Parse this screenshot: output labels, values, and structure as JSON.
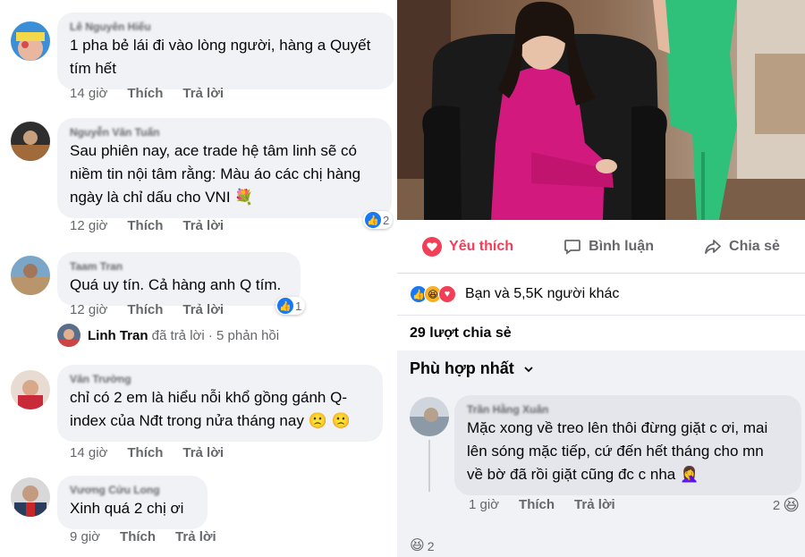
{
  "left": {
    "comments": [
      {
        "name": "Lê Nguyên Hiếu",
        "lines": [
          "1 pha bẻ lái đi vào lòng người, hàng a Quyết",
          "tím hết"
        ],
        "time": "14 giờ",
        "like": "Thích",
        "reply": "Trả lời"
      },
      {
        "name": "Nguyễn Văn Tuấn",
        "lines": [
          "Sau phiên nay, ace trade hệ tâm linh sẽ có",
          "niềm tin nội tâm rằng: Màu áo các chị hàng",
          "ngày là chỉ dấu cho VNI 💐"
        ],
        "time": "12 giờ",
        "like": "Thích",
        "reply": "Trả lời",
        "reaction_count": "2"
      },
      {
        "name": "Taam Tran",
        "lines": [
          "Quá uy tín. Cả hàng anh Q tím."
        ],
        "time": "12 giờ",
        "like": "Thích",
        "reply": "Trả lời",
        "reaction_count": "1"
      },
      {
        "name": "Văn Trường",
        "lines": [
          "chỉ có 2 em là hiểu nỗi khổ gồng gánh Q-",
          "index của Nđt trong nửa tháng nay 🙁 🙁"
        ],
        "time": "14 giờ",
        "like": "Thích",
        "reply": "Trả lời"
      },
      {
        "name": "Vương Cửu Long",
        "lines": [
          "Xinh quá 2 chị ơi"
        ],
        "time": "9 giờ",
        "like": "Thích",
        "reply": "Trả lời"
      }
    ],
    "reply_summary": {
      "name": "Linh Tran",
      "text": "đã trả lời · 5 phản hồi"
    }
  },
  "right": {
    "actions": {
      "like": "Yêu thích",
      "comment": "Bình luận",
      "share": "Chia sẻ"
    },
    "reactions_summary": "Bạn và 5,5K người khác",
    "shares": "29 lượt chia sẻ",
    "sort": "Phù hợp nhất",
    "comment": {
      "name": "Trần Hằng Xuân",
      "lines": [
        "Mặc xong về treo lên thôi đừng giặt c ơi, mai",
        "lên sóng mặc tiếp, cứ đến hết tháng cho mn",
        "về bờ đã rồi giặt cũng đc c nha 🤦‍♀️"
      ],
      "time": "1 giờ",
      "like": "Thích",
      "reply": "Trả lời",
      "reaction_count": "2"
    },
    "bottom_reaction_count": "2"
  },
  "colors": {
    "like_blue": "#1877f2",
    "love_red": "#f33e58",
    "bubble_gray": "#f0f2f5",
    "meta_gray": "#65676b",
    "pink_dress": "#d2197e",
    "green_dress": "#2fc07a"
  }
}
